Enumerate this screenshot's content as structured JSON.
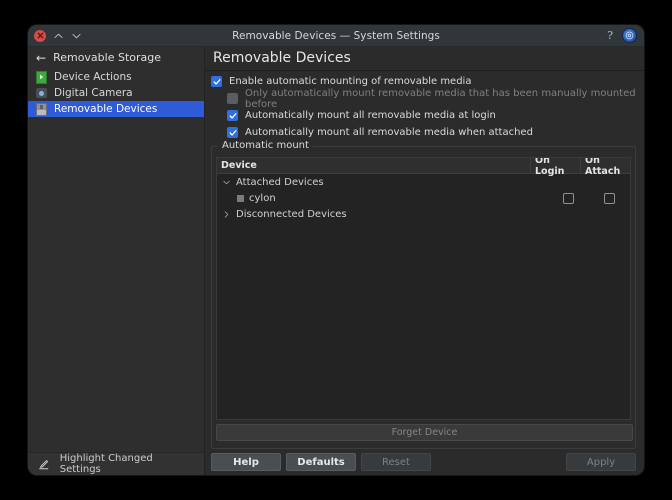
{
  "window": {
    "title": "Removable Devices — System Settings",
    "controls": {
      "close": "close-button",
      "shade_up": "shade-up-button",
      "shade_down": "shade-down-button",
      "help": "?",
      "configure": "configure-button"
    }
  },
  "sidebar": {
    "back_label": "Removable Storage",
    "items": [
      {
        "label": "Device Actions",
        "icon": "play-icon",
        "selected": false
      },
      {
        "label": "Digital Camera",
        "icon": "camera-icon",
        "selected": false
      },
      {
        "label": "Removable Devices",
        "icon": "drive-icon",
        "selected": true
      }
    ],
    "status": {
      "label": "Highlight Changed Settings",
      "icon": "pencil-icon"
    }
  },
  "main": {
    "page_title": "Removable Devices",
    "checkboxes": [
      {
        "label": "Enable automatic mounting of removable media",
        "state": "checked",
        "indent": false,
        "disabled": false
      },
      {
        "label": "Only automatically mount removable media that has been manually mounted before",
        "state": "disabled",
        "indent": true,
        "disabled": true
      },
      {
        "label": "Automatically mount all removable media at login",
        "state": "checked",
        "indent": true,
        "disabled": false
      },
      {
        "label": "Automatically mount all removable media when attached",
        "state": "checked",
        "indent": true,
        "disabled": false
      }
    ],
    "group": {
      "legend": "Automatic mount",
      "table": {
        "columns": [
          "Device",
          "On Login",
          "On Attach"
        ],
        "rows": [
          {
            "label": "Attached Devices",
            "type": "group",
            "expander": "expanded",
            "indent": 0,
            "on_login": null,
            "on_attach": null
          },
          {
            "label": "cylon",
            "type": "device",
            "expander": "none",
            "indent": 1,
            "on_login": "unchecked",
            "on_attach": "unchecked"
          },
          {
            "label": "Disconnected Devices",
            "type": "group",
            "expander": "collapsed",
            "indent": 0,
            "on_login": null,
            "on_attach": null
          }
        ]
      },
      "forget_button": {
        "label": "Forget Device",
        "disabled": true
      }
    }
  },
  "buttons": [
    {
      "label": "Help",
      "disabled": false
    },
    {
      "label": "Defaults",
      "disabled": false
    },
    {
      "label": "Reset",
      "disabled": true
    },
    {
      "label": "Apply",
      "disabled": true
    }
  ],
  "colors": {
    "selection": "#2f5ad8",
    "checkbox_on": "#2f6fe0",
    "close": "#d34b4b",
    "window_bg": "#2b2b2b",
    "sidebar_bg": "#2e2e2e",
    "tree_bg": "#232323"
  }
}
